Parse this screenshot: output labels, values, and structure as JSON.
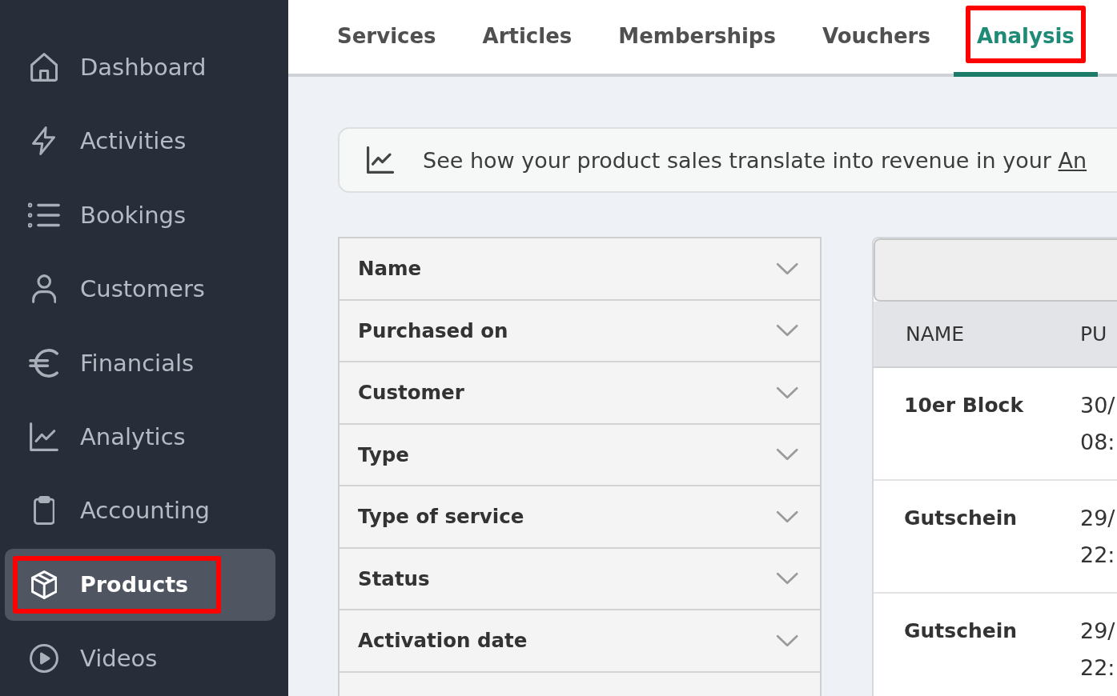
{
  "sidebar": {
    "items": [
      {
        "label": "Dashboard",
        "selected": false,
        "annotated": false
      },
      {
        "label": "Activities",
        "selected": false,
        "annotated": false
      },
      {
        "label": "Bookings",
        "selected": false,
        "annotated": false
      },
      {
        "label": "Customers",
        "selected": false,
        "annotated": false
      },
      {
        "label": "Financials",
        "selected": false,
        "annotated": false
      },
      {
        "label": "Analytics",
        "selected": false,
        "annotated": false
      },
      {
        "label": "Accounting",
        "selected": false,
        "annotated": false
      },
      {
        "label": "Products",
        "selected": true,
        "annotated": true
      },
      {
        "label": "Videos",
        "selected": false,
        "annotated": false
      }
    ]
  },
  "tabs": [
    {
      "label": "Services",
      "selected": false,
      "annotated": false
    },
    {
      "label": "Articles",
      "selected": false,
      "annotated": false
    },
    {
      "label": "Memberships",
      "selected": false,
      "annotated": false
    },
    {
      "label": "Vouchers",
      "selected": false,
      "annotated": false
    },
    {
      "label": "Analysis",
      "selected": true,
      "annotated": true
    }
  ],
  "banner": {
    "text": "See how your product sales translate into revenue in your ",
    "link": "An"
  },
  "filters": [
    {
      "label": "Name",
      "expanded": false
    },
    {
      "label": "Purchased on",
      "expanded": false
    },
    {
      "label": "Customer",
      "expanded": false
    },
    {
      "label": "Type",
      "expanded": false
    },
    {
      "label": "Type of service",
      "expanded": false
    },
    {
      "label": "Status",
      "expanded": false
    },
    {
      "label": "Activation date",
      "expanded": false
    }
  ],
  "table": {
    "columns": [
      "NAME",
      "PU"
    ],
    "rows": [
      {
        "cells": [
          "10er Block",
          "30/ 08:"
        ]
      },
      {
        "cells": [
          "Gutschein",
          "29/ 22:"
        ]
      },
      {
        "cells": [
          "Gutschein",
          "29/ 22:"
        ]
      }
    ]
  }
}
